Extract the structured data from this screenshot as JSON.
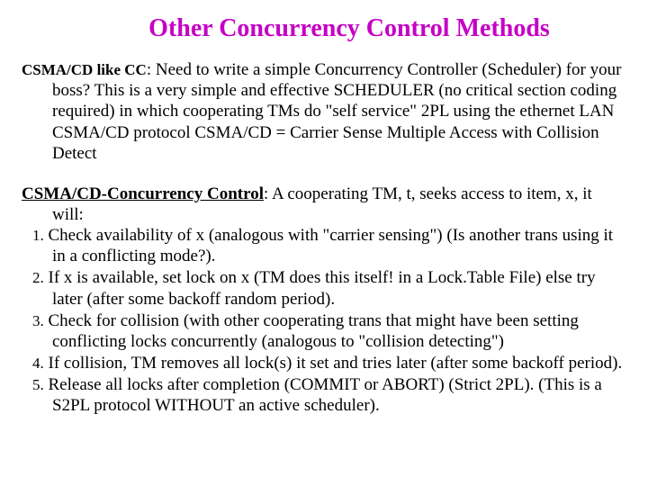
{
  "title": "Other Concurrency Control Methods",
  "section1": {
    "lead": "CSMA/CD like CC",
    "text": ":  Need to write a simple Concurrency Controller (Scheduler) for your boss?  This is a very simple and effective SCHEDULER (no critical section coding required) in which cooperating TMs do \"self service\" 2PL using the ethernet LAN CSMA/CD protocol CSMA/CD = Carrier Sense Multiple Access with Collision Detect"
  },
  "section2": {
    "lead": "CSMA/CD-Concurrency Control",
    "intro_tail": ": A cooperating TM, t, seeks access to item, x, it",
    "intro_tail2": "will:",
    "items": [
      {
        "n": "1.",
        "t": "Check availability of x (analogous with \"carrier sensing\") (Is another trans using it in a conflicting mode?)."
      },
      {
        "n": "2.",
        "t": "If x is available, set lock on x (TM does this itself! in a Lock.Table File) else try later (after some backoff random period)."
      },
      {
        "n": "3.",
        "t": "Check for collision (with other cooperating trans that might have been setting conflicting locks concurrently (analogous to \"collision detecting\")"
      },
      {
        "n": "4.",
        "t": "If collision, TM removes all lock(s) it set and tries later (after some backoff period)."
      },
      {
        "n": "5.",
        "t": "Release all locks after completion (COMMIT or ABORT) (Strict 2PL). (This is a S2PL protocol WITHOUT an active scheduler)."
      }
    ]
  }
}
